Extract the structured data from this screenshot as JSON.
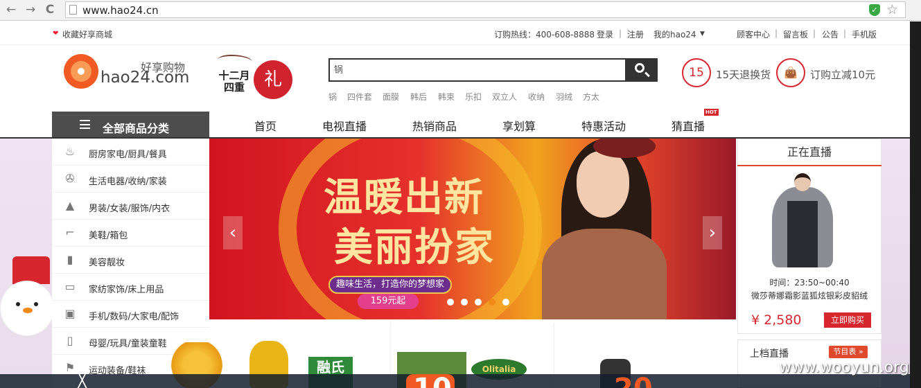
{
  "browser": {
    "url": "www.hao24.cn",
    "back_icon": "←",
    "forward_icon": "→",
    "reload_icon": "C",
    "star_icon": "☆",
    "shield_icon": "✓"
  },
  "topbar": {
    "favorite": "收藏好享商城",
    "hotline": "订购热线：400-608-8888",
    "login": "登录",
    "register": "注册",
    "my_account": "我的hao24",
    "customer_center": "顾客中心",
    "message_board": "留言板",
    "notice": "公告",
    "mobile": "手机版"
  },
  "logo": {
    "cn": "好享购物",
    "en": "hao24.com"
  },
  "promo": {
    "text": "十二月四重",
    "badge": "礼"
  },
  "search": {
    "value": "锅",
    "hot_keywords": [
      "锅",
      "四件套",
      "面膜",
      "韩后",
      "韩束",
      "乐扣",
      "双立人",
      "收纳",
      "羽绒",
      "方太"
    ]
  },
  "services": [
    {
      "icon_text": "15",
      "label": "15天退换货"
    },
    {
      "icon_text": "👜",
      "label": "订购立减10元"
    }
  ],
  "categories_title": "全部商品分类",
  "categories": [
    {
      "icon": "pot-icon",
      "glyph": "♨",
      "label": "厨房家电/厨具/餐具"
    },
    {
      "icon": "fan-icon",
      "glyph": "✇",
      "label": "生活电器/收纳/家装"
    },
    {
      "icon": "dress-icon",
      "glyph": "▲",
      "label": "男装/女装/服饰/内衣"
    },
    {
      "icon": "heel-icon",
      "glyph": "⌐",
      "label": "美鞋/箱包"
    },
    {
      "icon": "lipstick-icon",
      "glyph": "▮",
      "label": "美容靓妆"
    },
    {
      "icon": "bed-icon",
      "glyph": "▭",
      "label": "家纺家饰/床上用品"
    },
    {
      "icon": "laptop-icon",
      "glyph": "▣",
      "label": "手机/数码/大家电/配饰"
    },
    {
      "icon": "bottle-icon",
      "glyph": "▯",
      "label": "母婴/玩具/童装童鞋"
    },
    {
      "icon": "sports-icon",
      "glyph": "⚑",
      "label": "运动装备/鞋袜"
    }
  ],
  "main_nav": [
    "首页",
    "电视直播",
    "热销商品",
    "享划算",
    "特惠活动",
    "猜直播"
  ],
  "hot_badge": "HOT",
  "banner": {
    "title_line1": "温暖出新",
    "title_line2": "美丽扮家",
    "slogan": "趣味生活，打造你的梦想家",
    "price_tag": "159元起",
    "prev_icon": "‹",
    "next_icon": "›",
    "active_slide": 4,
    "slide_count": 5
  },
  "live": {
    "title": "正在直播",
    "time": "时间：23:50~00:40",
    "description": "微莎蒂娜霜影蓝狐炫银彩皮貂绒",
    "price": "¥ 2,580",
    "buy_label": "立即购买"
  },
  "previous": {
    "title": "上档直播",
    "schedule_label": "节目表 »"
  },
  "products": {
    "brand1": "融氏",
    "brand2": "Olitalia",
    "number1": "10",
    "number2": "20"
  },
  "watermark": "www.wooyun.org",
  "colors": {
    "accent": "#d8262f",
    "logo_orange": "#f15a22",
    "category_header": "#4d4d4d"
  }
}
